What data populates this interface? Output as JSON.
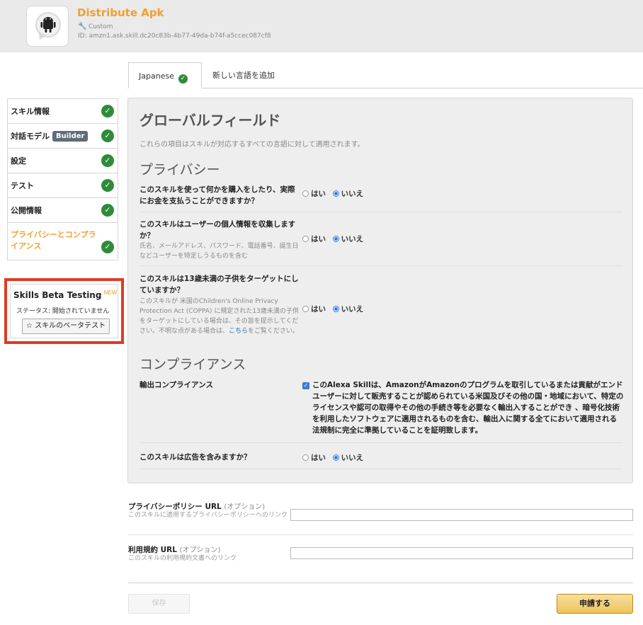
{
  "header": {
    "title": "Distribute Apk",
    "type": "Custom",
    "id": "ID:  amzn1.ask.skill.dc20c83b-4b77-49da-b74f-a5ccec087cf8"
  },
  "tabs": [
    {
      "label": "Japanese",
      "active": true
    },
    {
      "label": "新しい言語を追加",
      "active": false
    }
  ],
  "sidebar": {
    "items": [
      {
        "label": "スキル情報"
      },
      {
        "label": "対話モデル",
        "badge": "Builder"
      },
      {
        "label": "設定"
      },
      {
        "label": "テスト"
      },
      {
        "label": "公開情報"
      },
      {
        "label": "プライバシーとコンプライアンス"
      }
    ]
  },
  "beta": {
    "title": "Skills Beta Testing",
    "new_tag": "NEW",
    "status": "ステータス: 開始されていません",
    "button": "☆ スキルのベータテスト"
  },
  "main": {
    "heading": "グローバルフィールド",
    "description": "これらの項目はスキルが対応するすべての言語に対して適用されます。",
    "privacy_heading": "プライバシー",
    "compliance_heading": "コンプライアンス",
    "yes": "はい",
    "no": "いいえ",
    "q1": "このスキルを使って何かを購入をしたり、実際にお金を支払うことができますか？",
    "q2": "このスキルはユーザーの個人情報を収集しますか？",
    "q2_sub": "氏名、メールアドレス、パスワード、電話番号、誕生日などユーザーを特定しうるものを含む",
    "q3": "このスキルは13歳未満の子供をターゲットにしていますか？",
    "q3_sub": "このスキルが 米国のChildren's Online Privacy Protection Act (COPPA) に規定された13歳未満の子供をターゲットにしている場合は、その旨を提示してください。不明な点がある場合は、",
    "q3_link": "こちら",
    "q3_sub_end": "をご覧ください。",
    "export_label": "輸出コンプライアンス",
    "export_text": "このAlexa Skillは、AmazonがAmazonのプログラムを取引しているまたは貢献がエンドユーザーに対して販売することが認められている米国及びその他の国・地域において、特定のライセンスや認可の取得やその他の手続き等を必要なく輸出入することができ 、暗号化技術を利用したソフトウェアに適用されるものを含む、輸出入に関する全てにおいて適用される法規制に完全に準拠していることを証明致します。",
    "q4": "このスキルは広告を含みますか？"
  },
  "fields": {
    "privacy_label": "プライバシーポリシー URL",
    "privacy_opt": "(オプション)",
    "privacy_hint": "このスキルに適用するプライバシーポリシーへのリンク",
    "terms_label": "利用規約 URL",
    "terms_opt": "(オプション)",
    "terms_hint": "このスキルの利用規約文書へのリンク"
  },
  "footer": {
    "save": "保存",
    "submit": "申請する"
  }
}
